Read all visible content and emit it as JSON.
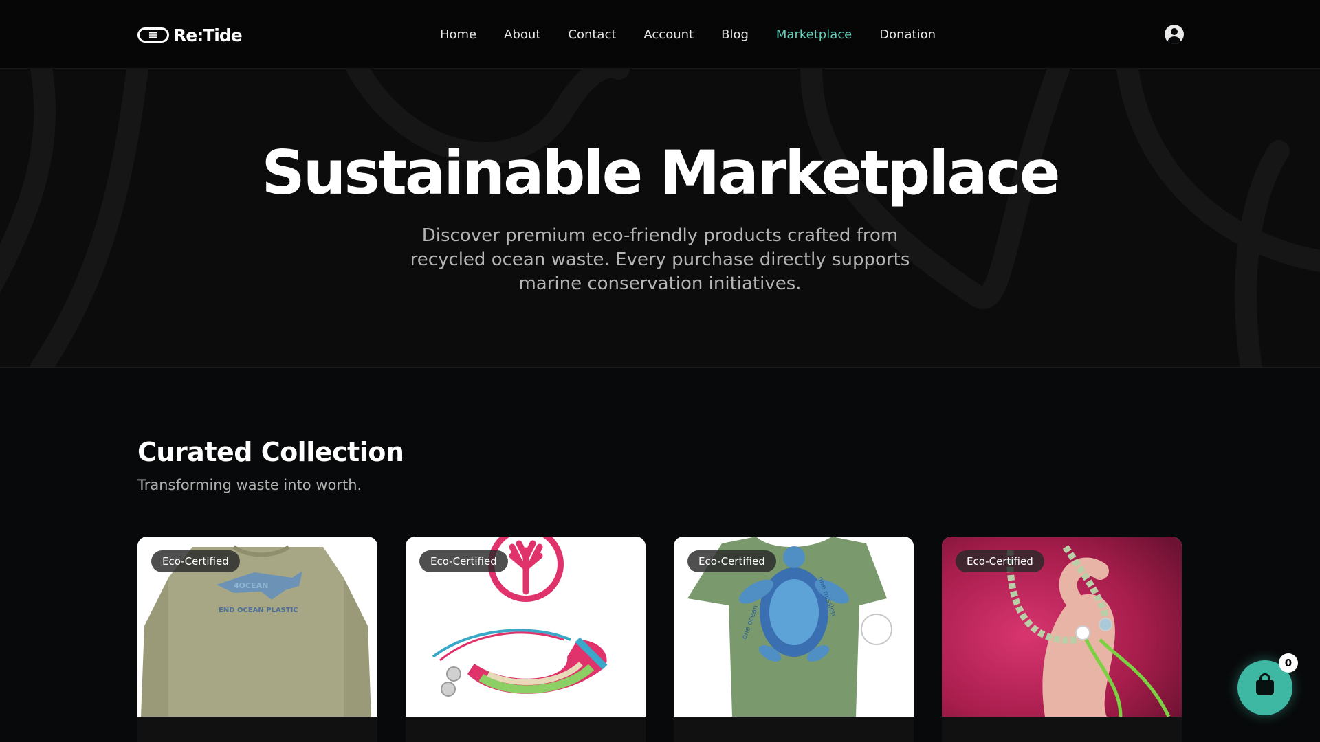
{
  "brand": {
    "name": "Re:Tide"
  },
  "nav": {
    "items": [
      {
        "label": "Home",
        "active": false
      },
      {
        "label": "About",
        "active": false
      },
      {
        "label": "Contact",
        "active": false
      },
      {
        "label": "Account",
        "active": false
      },
      {
        "label": "Blog",
        "active": false
      },
      {
        "label": "Marketplace",
        "active": true
      },
      {
        "label": "Donation",
        "active": false
      }
    ],
    "user_icon": "user-circle-icon"
  },
  "hero": {
    "title": "Sustainable Marketplace",
    "subtitle": "Discover premium eco-friendly products crafted from recycled ocean waste. Every purchase directly supports marine conservation initiatives."
  },
  "collection": {
    "title": "Curated Collection",
    "subtitle": "Transforming waste into worth.",
    "products": [
      {
        "badge": "Eco-Certified",
        "image_text": "END OCEAN PLASTIC",
        "image_name": "shark-sweatshirt-image"
      },
      {
        "badge": "Eco-Certified",
        "image_name": "woven-bracelet-image"
      },
      {
        "badge": "Eco-Certified",
        "image_text_left": "one ocean",
        "image_text_right": "one mission",
        "image_name": "turtle-tshirt-image"
      },
      {
        "badge": "Eco-Certified",
        "image_name": "beaded-bracelet-hand-image"
      }
    ]
  },
  "cart": {
    "count": "0",
    "icon": "shopping-bag-icon"
  },
  "colors": {
    "accent": "#5fd0bb",
    "cart": "#3fb8a3",
    "background": "#08090a"
  }
}
